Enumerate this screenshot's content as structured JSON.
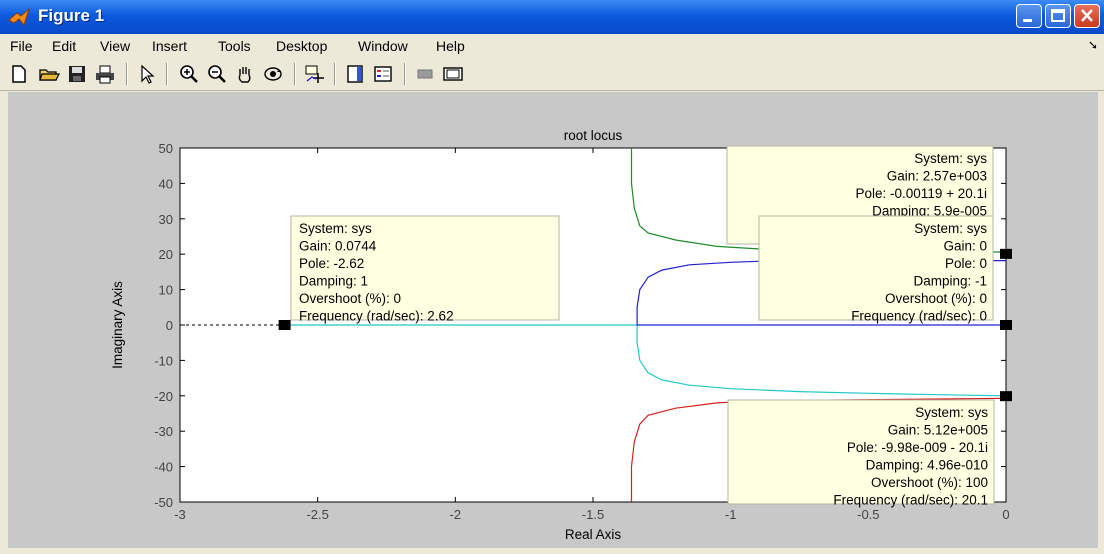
{
  "window": {
    "title": "Figure 1"
  },
  "menu": [
    "File",
    "Edit",
    "View",
    "Insert",
    "Tools",
    "Desktop",
    "Window",
    "Help"
  ],
  "toolbar_icons": [
    "new-file-icon",
    "open-folder-icon",
    "save-icon",
    "print-icon",
    "pointer-icon",
    "zoom-in-icon",
    "zoom-out-icon",
    "pan-hand-icon",
    "rotate-3d-icon",
    "data-cursor-icon",
    "colorbar-icon",
    "legend-icon",
    "hide-plot-tools-icon",
    "show-plot-tools-icon"
  ],
  "colors": {
    "titlebar": "#0a5adf",
    "figure_bg": "#c8c8c8",
    "axes_bg": "#ffffff",
    "datatip_bg": "#ffffe1",
    "red": "#d62020",
    "green": "#1f8a2a",
    "blue": "#2020d0",
    "cyan": "#20c8c8"
  },
  "chart_data": {
    "type": "line",
    "title": "root locus",
    "xlabel": "Real Axis",
    "ylabel": "Imaginary Axis",
    "xlim": [
      -3,
      0
    ],
    "ylim": [
      -50,
      50
    ],
    "xticks": [
      "-3",
      "-2.5",
      "-2",
      "-1.5",
      "-1",
      "-0.5",
      "0"
    ],
    "yticks": [
      "50",
      "40",
      "30",
      "20",
      "10",
      "0",
      "-10",
      "-20",
      "-30",
      "-40",
      "-50"
    ],
    "series": [
      {
        "color": "#20c8c8",
        "points": [
          [
            -2.62,
            0
          ],
          [
            -1.34,
            0
          ],
          [
            -1.34,
            -5
          ],
          [
            -1.33,
            -10
          ],
          [
            -1.3,
            -13.5
          ],
          [
            -1.25,
            -15.5
          ],
          [
            -1.15,
            -17
          ],
          [
            -1.0,
            -18
          ],
          [
            -0.75,
            -18.8
          ],
          [
            -0.5,
            -19.3
          ],
          [
            -0.25,
            -19.7
          ],
          [
            0,
            -20
          ]
        ]
      },
      {
        "color": "#2020d0",
        "points": [
          [
            -1.34,
            0
          ],
          [
            -1.34,
            5
          ],
          [
            -1.33,
            10
          ],
          [
            -1.3,
            13.5
          ],
          [
            -1.25,
            15.5
          ],
          [
            -1.15,
            17
          ],
          [
            -1.0,
            17.7
          ],
          [
            -0.9,
            18
          ],
          [
            0,
            18.2
          ]
        ]
      },
      {
        "color": "#2020d0",
        "points": [
          [
            -1.34,
            0
          ],
          [
            0,
            0
          ]
        ]
      },
      {
        "color": "#1f8a2a",
        "points": [
          [
            -1.36,
            50
          ],
          [
            -1.36,
            40
          ],
          [
            -1.35,
            33
          ],
          [
            -1.33,
            28
          ],
          [
            -1.3,
            26
          ],
          [
            -1.2,
            24
          ],
          [
            -1.05,
            22.2
          ],
          [
            -0.9,
            21.5
          ],
          [
            0,
            20.6
          ]
        ]
      },
      {
        "color": "#d62020",
        "points": [
          [
            -1.36,
            -50
          ],
          [
            -1.36,
            -40
          ],
          [
            -1.35,
            -33
          ],
          [
            -1.33,
            -28
          ],
          [
            -1.3,
            -25.5
          ],
          [
            -1.2,
            -23.5
          ],
          [
            -1.05,
            -22
          ],
          [
            -0.9,
            -21.4
          ],
          [
            0,
            -20.7
          ]
        ]
      }
    ],
    "dashed_axis_segment": {
      "x_from": -3,
      "x_to": -2.62,
      "y": 0
    },
    "markers": [
      {
        "x": -2.62,
        "y": 0
      },
      {
        "x": 0,
        "y": 20.1
      },
      {
        "x": 0,
        "y": 0
      },
      {
        "x": 0,
        "y": -20.1
      }
    ],
    "datatips": [
      {
        "id": "tip-a",
        "x": -0.00119,
        "y": 20.1,
        "align": "right",
        "lines": [
          "System: sys",
          "Gain: 2.57e+003",
          "Pole: -0.00119 + 20.1i",
          "Damping: 5.9e-005"
        ]
      },
      {
        "id": "tip-b",
        "x": -2.62,
        "y": 0,
        "align": "left",
        "lines": [
          "System: sys",
          "Gain: 0.0744",
          "Pole: -2.62",
          "Damping: 1",
          "Overshoot (%): 0",
          "Frequency (rad/sec): 2.62"
        ]
      },
      {
        "id": "tip-c",
        "x": 0,
        "y": 0,
        "align": "right",
        "lines": [
          "System: sys",
          "Gain: 0",
          "Pole: 0",
          "Damping: -1",
          "Overshoot (%): 0",
          "Frequency (rad/sec): 0"
        ]
      },
      {
        "id": "tip-d",
        "x": -9.98e-09,
        "y": -20.1,
        "align": "right",
        "lines": [
          "System: sys",
          "Gain: 5.12e+005",
          "Pole: -9.98e-009 - 20.1i",
          "Damping: 4.96e-010",
          "Overshoot (%): 100",
          "Frequency (rad/sec): 20.1"
        ]
      }
    ],
    "grid": false
  }
}
